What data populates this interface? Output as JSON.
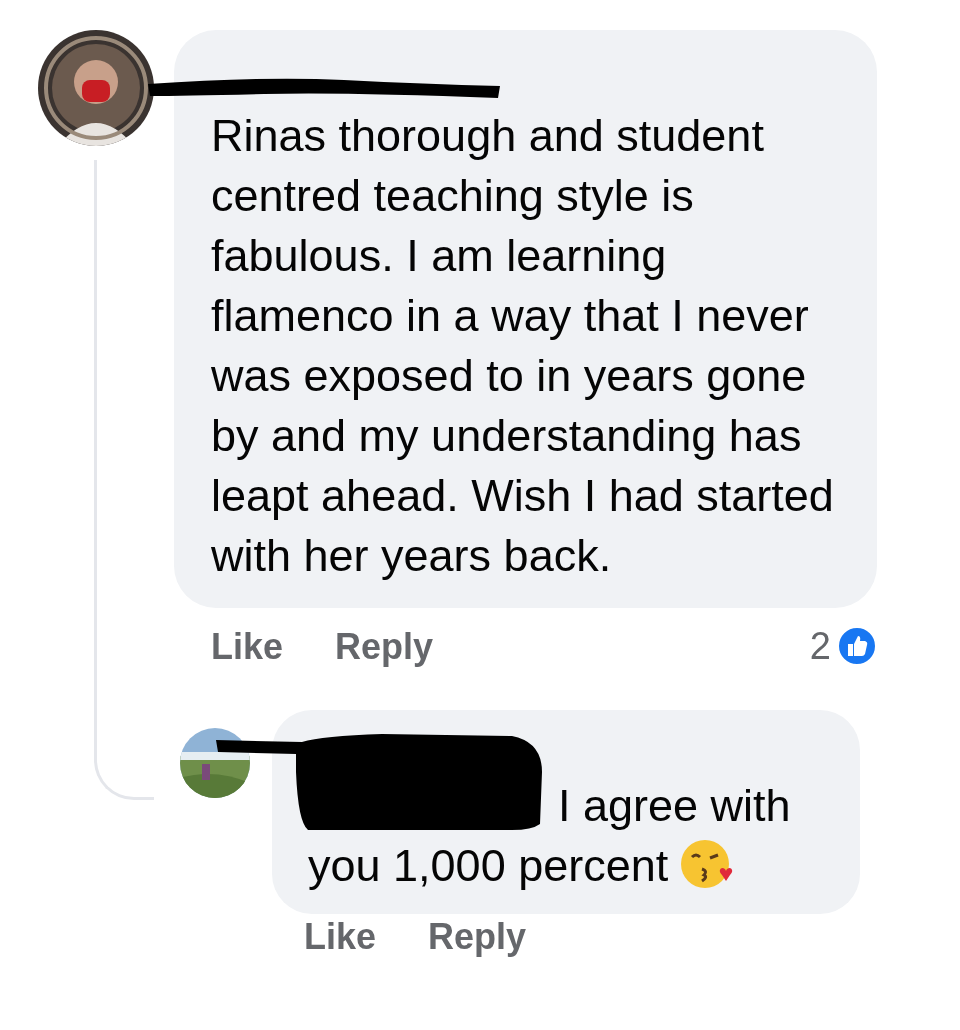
{
  "comments": [
    {
      "text": "Rinas thorough and student centred teaching style is fabulous. I am learning flamenco in a way that I never was exposed to in years gone by and my understanding has leapt ahead. Wish I had started with her years back.",
      "actions": [
        "Like",
        "Reply"
      ],
      "reaction_count": "2",
      "redacted": true,
      "emoji": false
    },
    {
      "text": "I agree with you 1,000 percent",
      "actions": [
        "Like",
        "Reply"
      ],
      "redacted": true,
      "emoji": true
    }
  ]
}
